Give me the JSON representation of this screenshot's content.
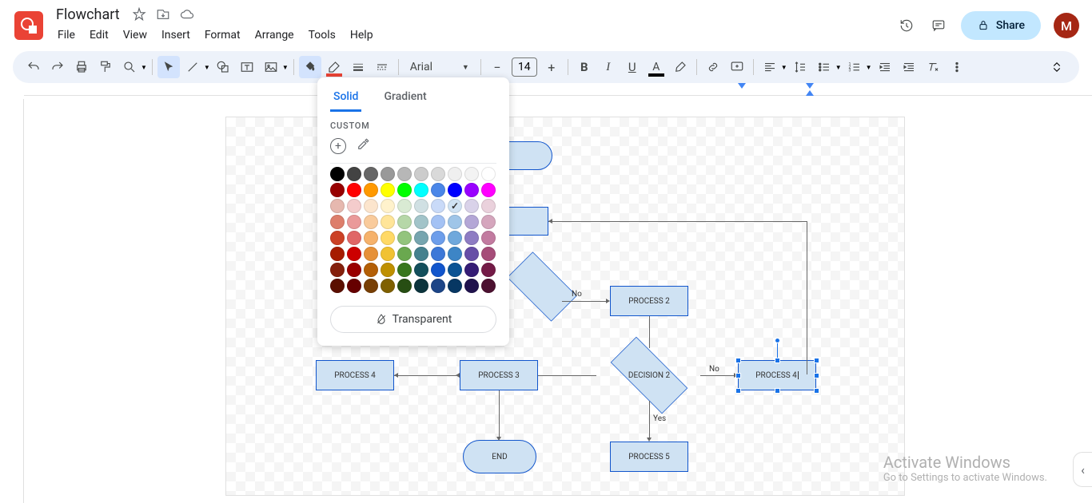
{
  "doc_title": "Flowchart",
  "menu": {
    "file": "File",
    "edit": "Edit",
    "view": "View",
    "insert": "Insert",
    "format": "Format",
    "arrange": "Arrange",
    "tools": "Tools",
    "help": "Help"
  },
  "share_label": "Share",
  "avatar_initial": "M",
  "font_name": "Arial",
  "font_size": "14",
  "color_popover": {
    "tab_solid": "Solid",
    "tab_gradient": "Gradient",
    "custom_label": "CUSTOM",
    "transparent_label": "Transparent",
    "row_grays": [
      "#000000",
      "#434343",
      "#666666",
      "#999999",
      "#b7b7b7",
      "#cccccc",
      "#d9d9d9",
      "#efefef",
      "#f3f3f3",
      "#ffffff"
    ],
    "row_brights": [
      "#980000",
      "#ff0000",
      "#ff9900",
      "#ffff00",
      "#00ff00",
      "#00ffff",
      "#4a86e8",
      "#0000ff",
      "#9900ff",
      "#ff00ff"
    ],
    "shades": [
      [
        "#e6b8af",
        "#f4cccc",
        "#fce5cd",
        "#fff2cc",
        "#d9ead3",
        "#d0e0e3",
        "#c9daf8",
        "#cfe2f3",
        "#d9d2e9",
        "#ead1dc"
      ],
      [
        "#dd7e6b",
        "#ea9999",
        "#f9cb9c",
        "#ffe599",
        "#b6d7a8",
        "#a2c4c9",
        "#a4c2f4",
        "#9fc5e8",
        "#b4a7d6",
        "#d5a6bd"
      ],
      [
        "#cc4125",
        "#e06666",
        "#f6b26b",
        "#ffd966",
        "#93c47d",
        "#76a5af",
        "#6d9eeb",
        "#6fa8dc",
        "#8e7cc3",
        "#c27ba0"
      ],
      [
        "#a61c00",
        "#cc0000",
        "#e69138",
        "#f1c232",
        "#6aa84f",
        "#45818e",
        "#3c78d8",
        "#3d85c6",
        "#674ea7",
        "#a64d79"
      ],
      [
        "#85200c",
        "#990000",
        "#b45f06",
        "#bf9000",
        "#38761d",
        "#134f5c",
        "#1155cc",
        "#0b5394",
        "#351c75",
        "#741b47"
      ],
      [
        "#5b0f00",
        "#660000",
        "#783f04",
        "#7f6000",
        "#274e13",
        "#0c343d",
        "#1c4587",
        "#073763",
        "#20124d",
        "#4c1130"
      ]
    ],
    "selected_color": "#cfe2f3"
  },
  "shapes": {
    "process2": "PROCESS 2",
    "process3": "PROCESS 3",
    "process4_left": "PROCESS 4",
    "process4_right": "PROCESS 4",
    "process5": "PROCESS 5",
    "decision2": "DECISION 2",
    "end": "END"
  },
  "labels": {
    "no_top": "No",
    "no_right": "No",
    "yes": "Yes"
  },
  "watermark": {
    "line1": "Activate Windows",
    "line2": "Go to Settings to activate Windows."
  }
}
